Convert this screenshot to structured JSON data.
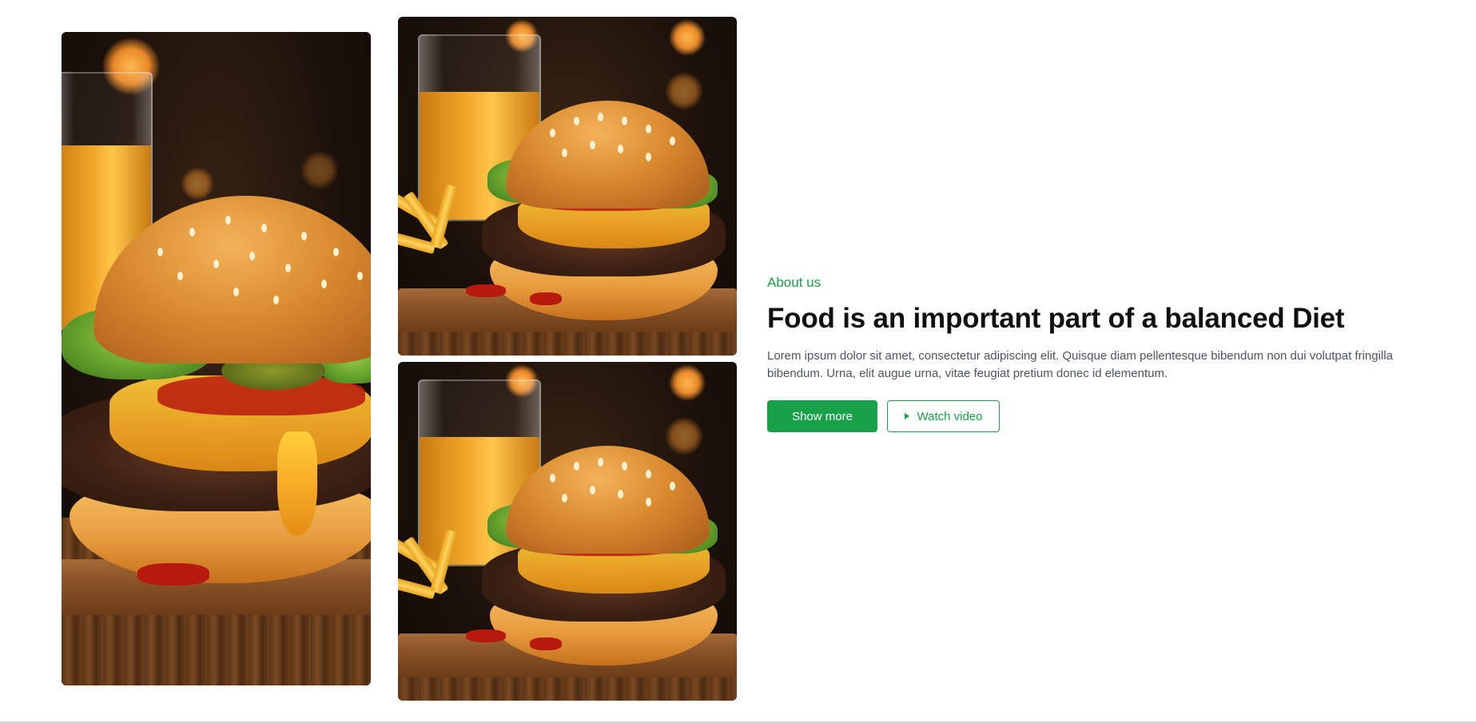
{
  "about": {
    "eyebrow": "About us",
    "title": "Food is an important part of a balanced Diet",
    "description": "Lorem ipsum dolor sit amet, consectetur adipiscing elit. Quisque diam pellentesque bibendum non dui volutpat fringilla bibendum. Urna, elit augue urna, vitae feugiat pretium donec id elementum."
  },
  "actions": {
    "show_more_label": "Show more",
    "watch_video_label": "Watch video",
    "watch_video_icon": "play-icon"
  },
  "gallery": {
    "images": [
      {
        "subject": "burger-photo",
        "crop": "close-up"
      },
      {
        "subject": "burger-photo",
        "crop": "full"
      },
      {
        "subject": "burger-photo",
        "crop": "full"
      }
    ]
  },
  "colors": {
    "accent": "#17a24a",
    "heading": "#101010",
    "body_text": "#4c5560",
    "background": "#ffffff"
  }
}
